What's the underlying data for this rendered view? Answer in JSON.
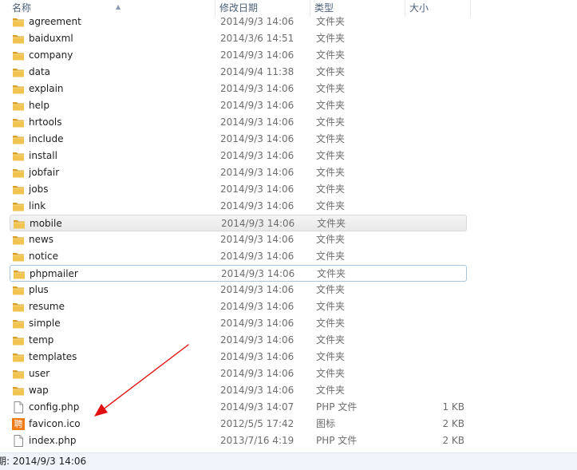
{
  "columns": {
    "name": "名称",
    "date": "修改日期",
    "type": "类型",
    "size": "大小"
  },
  "colors": {
    "folder": "#e8b436",
    "arrow": "#e01010",
    "hover_row": "#ececec",
    "focus_border": "#a7c4e0",
    "status_bg": "#f0f5fb"
  },
  "files": [
    {
      "name": "agreement",
      "date": "2014/9/3 14:06",
      "type": "文件夹",
      "size": "",
      "icon": "folder-icon"
    },
    {
      "name": "baiduxml",
      "date": "2014/3/6 14:51",
      "type": "文件夹",
      "size": "",
      "icon": "folder-icon"
    },
    {
      "name": "company",
      "date": "2014/9/3 14:06",
      "type": "文件夹",
      "size": "",
      "icon": "folder-icon"
    },
    {
      "name": "data",
      "date": "2014/9/4 11:38",
      "type": "文件夹",
      "size": "",
      "icon": "folder-icon"
    },
    {
      "name": "explain",
      "date": "2014/9/3 14:06",
      "type": "文件夹",
      "size": "",
      "icon": "folder-icon"
    },
    {
      "name": "help",
      "date": "2014/9/3 14:06",
      "type": "文件夹",
      "size": "",
      "icon": "folder-icon"
    },
    {
      "name": "hrtools",
      "date": "2014/9/3 14:06",
      "type": "文件夹",
      "size": "",
      "icon": "folder-icon"
    },
    {
      "name": "include",
      "date": "2014/9/3 14:06",
      "type": "文件夹",
      "size": "",
      "icon": "folder-icon"
    },
    {
      "name": "install",
      "date": "2014/9/3 14:06",
      "type": "文件夹",
      "size": "",
      "icon": "folder-icon"
    },
    {
      "name": "jobfair",
      "date": "2014/9/3 14:06",
      "type": "文件夹",
      "size": "",
      "icon": "folder-icon"
    },
    {
      "name": "jobs",
      "date": "2014/9/3 14:06",
      "type": "文件夹",
      "size": "",
      "icon": "folder-icon"
    },
    {
      "name": "link",
      "date": "2014/9/3 14:06",
      "type": "文件夹",
      "size": "",
      "icon": "folder-icon"
    },
    {
      "name": "mobile",
      "date": "2014/9/3 14:06",
      "type": "文件夹",
      "size": "",
      "icon": "folder-icon",
      "state": "hover"
    },
    {
      "name": "news",
      "date": "2014/9/3 14:06",
      "type": "文件夹",
      "size": "",
      "icon": "folder-icon"
    },
    {
      "name": "notice",
      "date": "2014/9/3 14:06",
      "type": "文件夹",
      "size": "",
      "icon": "folder-icon"
    },
    {
      "name": "phpmailer",
      "date": "2014/9/3 14:06",
      "type": "文件夹",
      "size": "",
      "icon": "folder-icon",
      "state": "focus"
    },
    {
      "name": "plus",
      "date": "2014/9/3 14:06",
      "type": "文件夹",
      "size": "",
      "icon": "folder-icon"
    },
    {
      "name": "resume",
      "date": "2014/9/3 14:06",
      "type": "文件夹",
      "size": "",
      "icon": "folder-icon"
    },
    {
      "name": "simple",
      "date": "2014/9/3 14:06",
      "type": "文件夹",
      "size": "",
      "icon": "folder-icon"
    },
    {
      "name": "temp",
      "date": "2014/9/3 14:06",
      "type": "文件夹",
      "size": "",
      "icon": "folder-icon"
    },
    {
      "name": "templates",
      "date": "2014/9/3 14:06",
      "type": "文件夹",
      "size": "",
      "icon": "folder-icon"
    },
    {
      "name": "user",
      "date": "2014/9/3 14:06",
      "type": "文件夹",
      "size": "",
      "icon": "folder-icon"
    },
    {
      "name": "wap",
      "date": "2014/9/3 14:06",
      "type": "文件夹",
      "size": "",
      "icon": "folder-icon"
    },
    {
      "name": "config.php",
      "date": "2014/9/3 14:07",
      "type": "PHP 文件",
      "size": "1 KB",
      "icon": "php-file-icon"
    },
    {
      "name": "favicon.ico",
      "date": "2012/5/5 17:42",
      "type": "图标",
      "size": "2 KB",
      "icon": "favicon-icon",
      "icon_glyph": "聘"
    },
    {
      "name": "index.php",
      "date": "2013/7/16 4:19",
      "type": "PHP 文件",
      "size": "2 KB",
      "icon": "php-file-icon"
    }
  ],
  "status": {
    "text": "期: 2014/9/3 14:06"
  }
}
